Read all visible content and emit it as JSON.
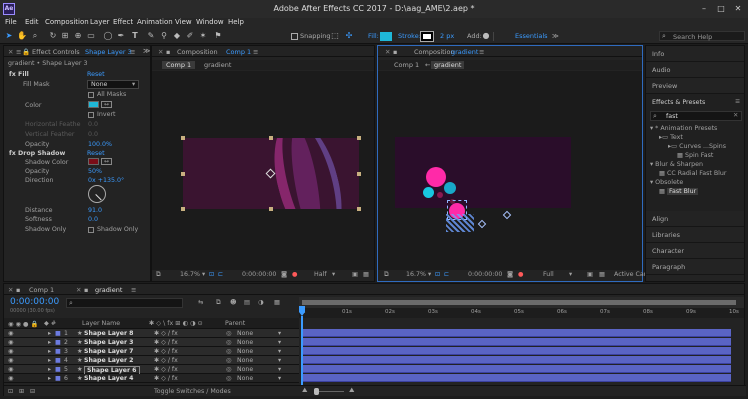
{
  "app": {
    "title": "Adobe After Effects CC 2017 - D:\\aag_AME\\2.aep *"
  },
  "menu": [
    "File",
    "Edit",
    "Composition",
    "Layer",
    "Effect",
    "Animation",
    "View",
    "Window",
    "Help"
  ],
  "toolbar": {
    "snapping": "Snapping",
    "fill": "Fill:",
    "stroke": "Stroke:",
    "stroke_px": "2 px",
    "add": "Add:",
    "workspace": "Essentials",
    "search_placeholder": "Search Help"
  },
  "effect_controls": {
    "tab": "Effect Controls",
    "layer": "Shape Layer 3",
    "breadcrumb": "gradient • Shape Layer 3",
    "fill": {
      "name": "Fill",
      "reset": "Reset",
      "mask_label": "Fill Mask",
      "mask_value": "None",
      "all_masks": "All Masks",
      "color": "Color",
      "invert": "Invert",
      "hfeather": "Horizontal Feathe",
      "hfeather_val": "0.0",
      "vfeather": "Vertical Feather",
      "vfeather_val": "0.0",
      "opacity": "Opacity",
      "opacity_val": "100.0%"
    },
    "drop_shadow": {
      "name": "Drop Shadow",
      "reset": "Reset",
      "color": "Shadow Color",
      "opacity": "Opacity",
      "opacity_val": "50%",
      "direction": "Direction",
      "direction_val": "0x +135.0°",
      "distance": "Distance",
      "distance_val": "91.0",
      "softness": "Softness",
      "softness_val": "0.0",
      "shadow_only": "Shadow Only",
      "shadow_only_cb": "Shadow Only"
    },
    "fx": "fx"
  },
  "comp1": {
    "tab": "Composition",
    "name": "Comp 1",
    "subtabs": [
      "Comp 1",
      "gradient"
    ],
    "zoom": "16.7%",
    "timecode": "0:00:00:00",
    "res": "Half"
  },
  "comp2": {
    "tab": "Composition",
    "name": "gradient",
    "subtabs": [
      "Comp 1",
      "gradient"
    ],
    "zoom": "16.7%",
    "timecode": "0:00:00:00",
    "res": "Full",
    "camera": "Active Cam"
  },
  "right": {
    "panels": [
      "Info",
      "Audio",
      "Preview"
    ],
    "effects": {
      "title": "Effects & Presets",
      "search": "fast",
      "tree": [
        {
          "t": "* Animation Presets",
          "d": 0,
          "k": "a"
        },
        {
          "t": "Text",
          "d": 1,
          "k": "f"
        },
        {
          "t": "Curves ...Spins",
          "d": 2,
          "k": "f"
        },
        {
          "t": "Spin Fast",
          "d": 3,
          "k": "p"
        },
        {
          "t": "Blur & Sharpen",
          "d": 0,
          "k": "a"
        },
        {
          "t": "CC Radial Fast Blur",
          "d": 1,
          "k": "p"
        },
        {
          "t": "Obsolete",
          "d": 0,
          "k": "a"
        },
        {
          "t": "Fast Blur",
          "d": 1,
          "k": "p",
          "sel": true
        }
      ]
    },
    "bottom": [
      "Align",
      "Libraries",
      "Character",
      "Paragraph"
    ]
  },
  "timeline": {
    "tabs": [
      "Comp 1",
      "gradient"
    ],
    "timecode": "0:00:00:00",
    "frames": "00000 (30.00 fps)",
    "col_name": "Layer Name",
    "col_parent": "Parent",
    "layers": [
      {
        "n": "1",
        "name": "Shape Layer 8",
        "parent": "None"
      },
      {
        "n": "2",
        "name": "Shape Layer 3",
        "parent": "None"
      },
      {
        "n": "3",
        "name": "Shape Layer 7",
        "parent": "None"
      },
      {
        "n": "4",
        "name": "Shape Layer 2",
        "parent": "None"
      },
      {
        "n": "5",
        "name": "Shape Layer 6",
        "parent": "None"
      },
      {
        "n": "6",
        "name": "Shape Layer 4",
        "parent": "None"
      }
    ],
    "ruler": [
      "0s",
      "01s",
      "02s",
      "03s",
      "04s",
      "05s",
      "06s",
      "07s",
      "08s",
      "09s",
      "10s"
    ],
    "toggle": "Toggle Switches / Modes"
  },
  "colors": {
    "accent": "#3b9bff",
    "fill_color": "#1fb8d8",
    "shadow_color": "#7a0d17",
    "bar": "#5a64c4",
    "magenta": "#ff2aa8",
    "cyan": "#18c8e0"
  }
}
